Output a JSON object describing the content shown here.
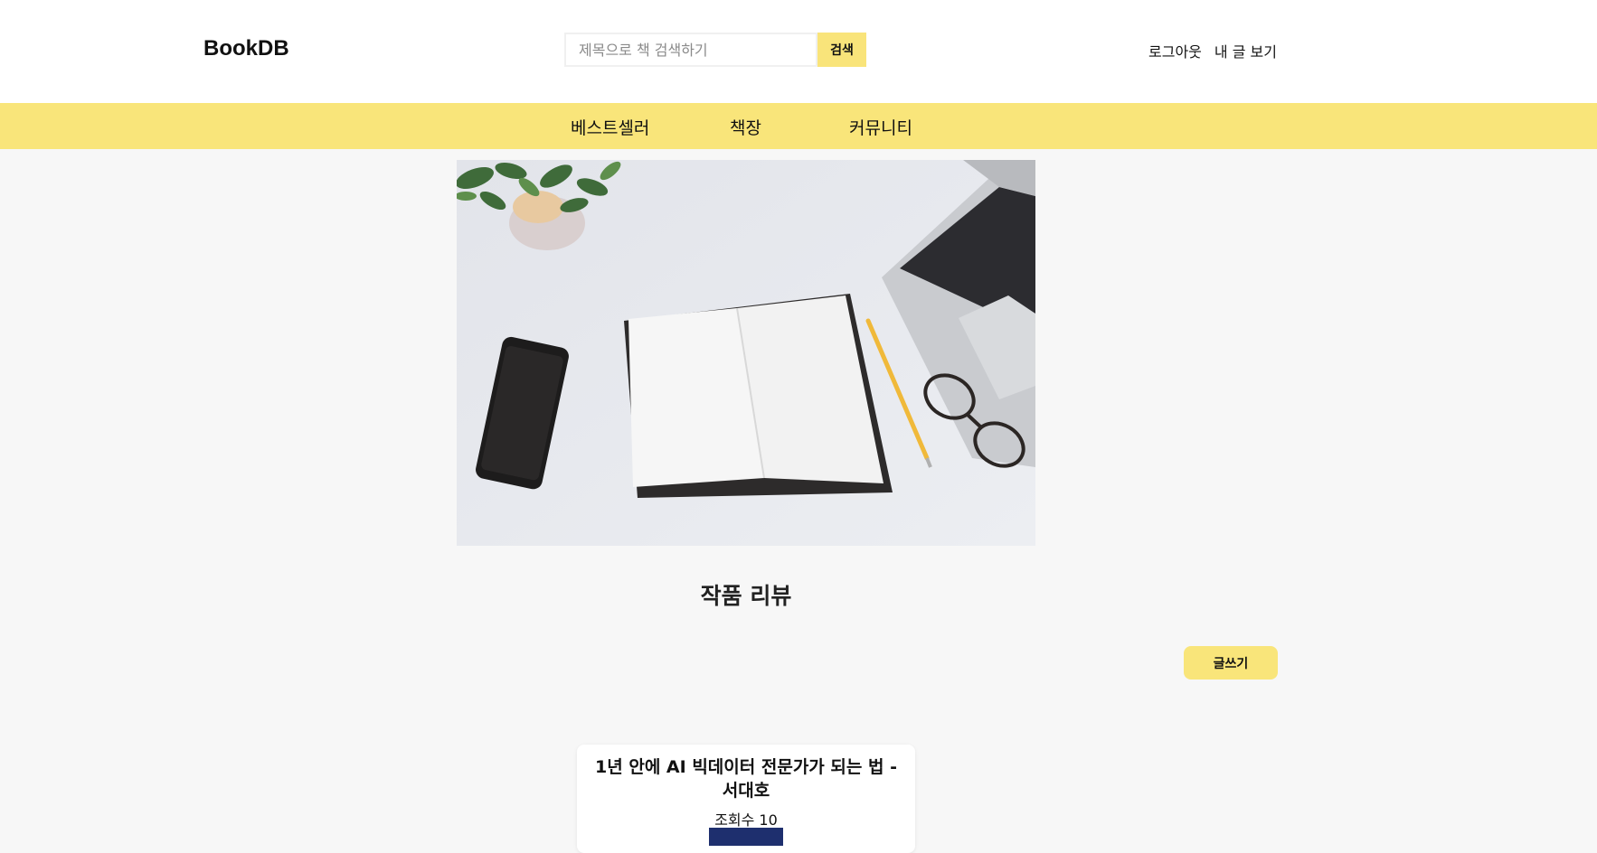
{
  "header": {
    "logo": "BookDB",
    "search_placeholder": "제목으로 책 검색하기",
    "search_button": "검색",
    "logout": "로그아웃",
    "my_posts": "내 글 보기"
  },
  "nav": {
    "items": [
      "베스트셀러",
      "책장",
      "커뮤니티"
    ]
  },
  "hero": {
    "description": "desk-workspace-image"
  },
  "main": {
    "section_title": "작품 리뷰",
    "write_button": "글쓰기"
  },
  "posts": [
    {
      "title": "1년 안에 AI 빅데이터 전문가가 되는 법 - 서대호",
      "views": "조회수 10"
    }
  ],
  "colors": {
    "accent": "#f9e57a",
    "page_bg": "#f7f7f7"
  }
}
